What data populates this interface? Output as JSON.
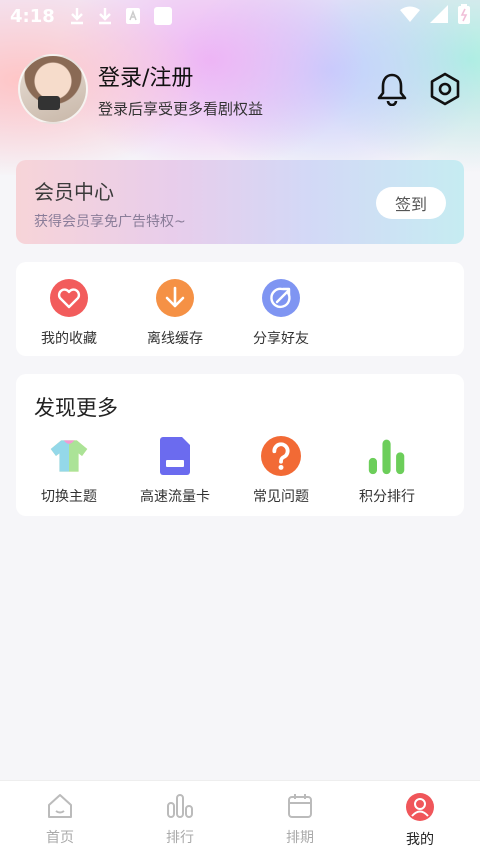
{
  "status_bar": {
    "time": "4:18"
  },
  "profile": {
    "login_label": "登录/注册",
    "subtitle": "登录后享受更多看剧权益"
  },
  "vip": {
    "title": "会员中心",
    "subtitle": "获得会员享免广告特权~",
    "checkin_label": "签到"
  },
  "quick_actions": [
    {
      "label": "我的收藏",
      "icon": "heart-icon",
      "color": "#f25c5c"
    },
    {
      "label": "离线缓存",
      "icon": "download-icon",
      "color": "#f59145"
    },
    {
      "label": "分享好友",
      "icon": "share-icon",
      "color": "#7f95f2"
    }
  ],
  "discover": {
    "title": "发现更多",
    "items": [
      {
        "label": "切换主题",
        "icon": "theme-shirt-icon"
      },
      {
        "label": "高速流量卡",
        "icon": "sim-card-icon",
        "color": "#6b6bef"
      },
      {
        "label": "常见问题",
        "icon": "question-icon",
        "color": "#f26a35"
      },
      {
        "label": "积分排行",
        "icon": "bar-chart-icon",
        "color": "#6cce5a"
      }
    ]
  },
  "tabs": [
    {
      "label": "首页",
      "icon": "home-icon"
    },
    {
      "label": "排行",
      "icon": "ranking-icon"
    },
    {
      "label": "排期",
      "icon": "calendar-icon"
    },
    {
      "label": "我的",
      "icon": "user-icon",
      "active": true,
      "color": "#f0565a"
    }
  ]
}
